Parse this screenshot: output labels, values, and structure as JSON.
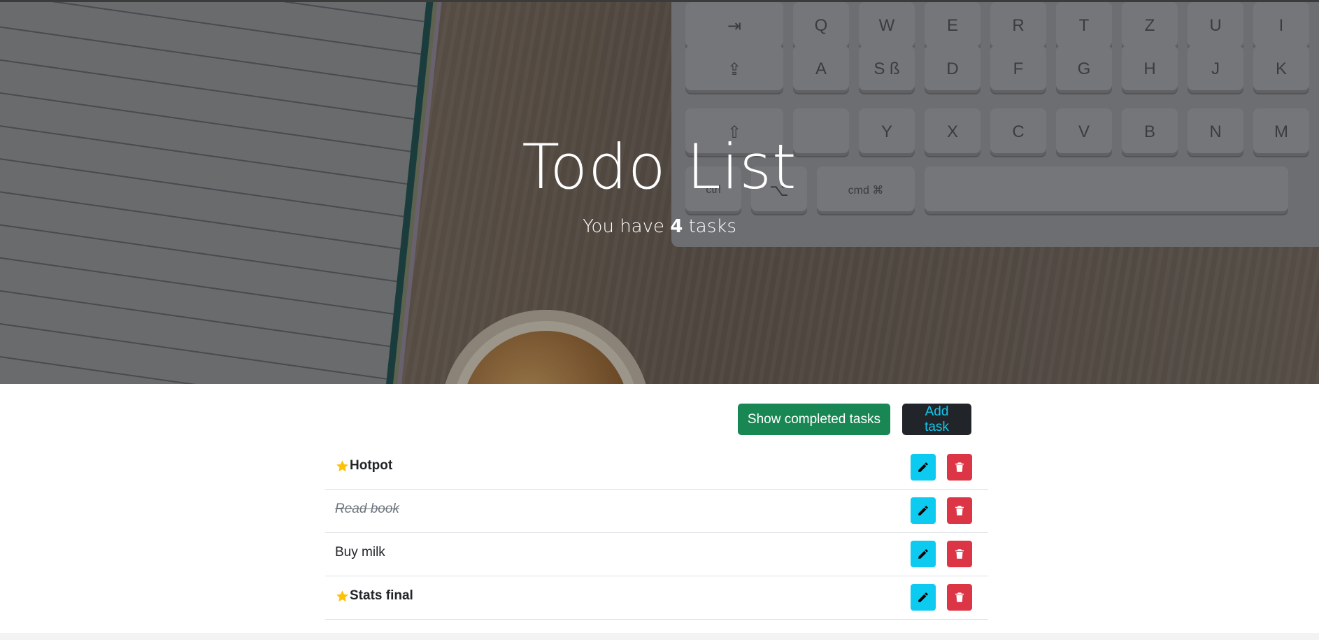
{
  "hero": {
    "title": "Todo List",
    "subtitle_prefix": "You have",
    "task_count": "4",
    "subtitle_suffix": "tasks"
  },
  "background_keys": {
    "row1": [
      "⇥",
      "Q",
      "W",
      "E",
      "R",
      "T",
      "Z",
      "U",
      "I"
    ],
    "row2": [
      "⇪",
      "A",
      "S ß",
      "D",
      "F",
      "G",
      "H",
      "J",
      "K"
    ],
    "row3": [
      "⇧",
      "",
      "Y",
      "X",
      "C",
      "V",
      "B",
      "N",
      "M"
    ],
    "row4": [
      "ctrl",
      "⌥",
      "cmd  ⌘"
    ]
  },
  "toolbar": {
    "show_completed_label": "Show completed tasks",
    "add_task_label": "Add task"
  },
  "tasks": [
    {
      "label": "Hotpot",
      "important": true,
      "completed": false
    },
    {
      "label": "Read book",
      "important": false,
      "completed": true
    },
    {
      "label": "Buy milk",
      "important": false,
      "completed": false
    },
    {
      "label": "Stats final",
      "important": true,
      "completed": false
    }
  ],
  "icons": {
    "edit": "pencil-icon",
    "delete": "trash-icon",
    "important": "star-icon"
  },
  "colors": {
    "success": "#198754",
    "dark": "#212529",
    "info": "#0dcaf0",
    "danger": "#dc3545",
    "star": "#ffc107"
  }
}
